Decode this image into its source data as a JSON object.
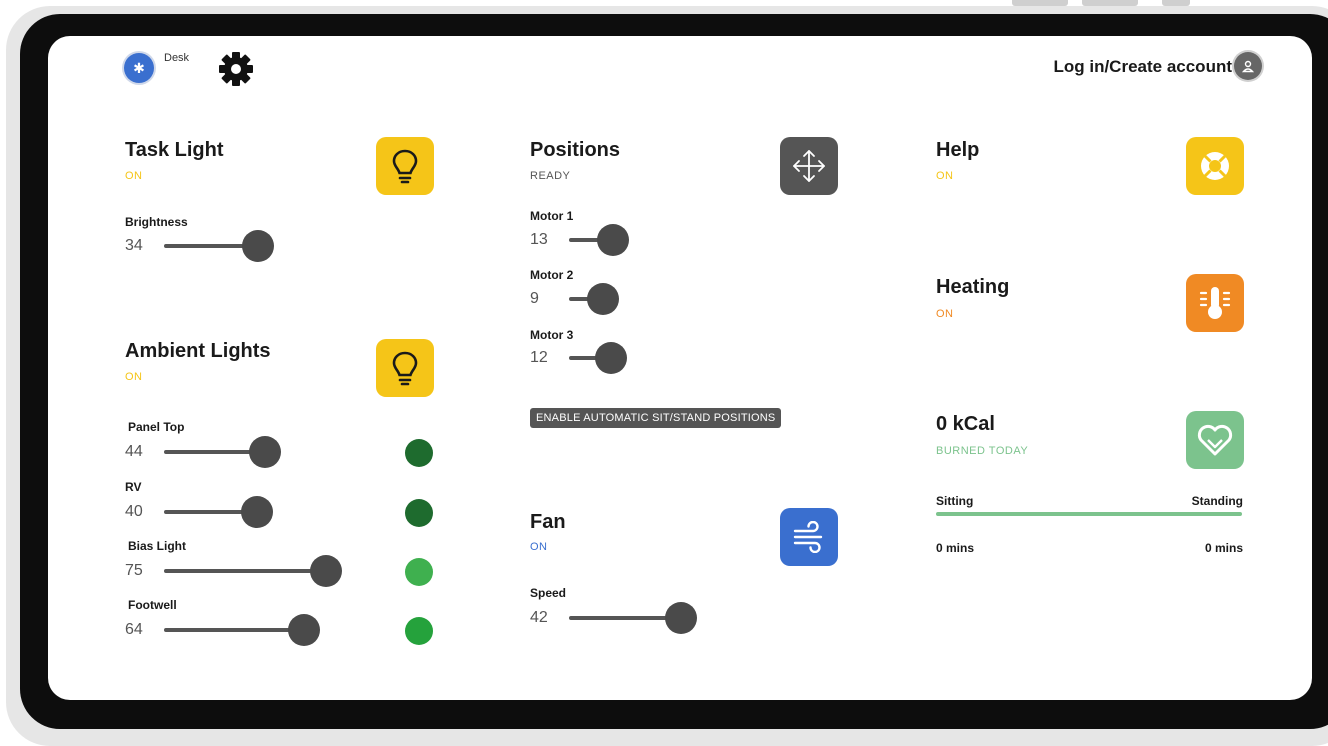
{
  "header": {
    "device_label": "Desk",
    "login_label": "Log in/Create account"
  },
  "task_light": {
    "title": "Task Light",
    "status": "ON",
    "brightness": {
      "label": "Brightness",
      "value": 34
    }
  },
  "ambient_lights": {
    "title": "Ambient Lights",
    "status": "ON",
    "channels": [
      {
        "label": "Panel Top",
        "value": 44,
        "dot_color": "#1e6b2e"
      },
      {
        "label": "RV",
        "value": 40,
        "dot_color": "#1e6b2e"
      },
      {
        "label": "Bias Light",
        "value": 75,
        "dot_color": "#3fb04f"
      },
      {
        "label": "Footwell",
        "value": 64,
        "dot_color": "#25a23c"
      }
    ]
  },
  "positions": {
    "title": "Positions",
    "status": "READY",
    "motors": [
      {
        "label": "Motor 1",
        "value": 13
      },
      {
        "label": "Motor 2",
        "value": 9
      },
      {
        "label": "Motor 3",
        "value": 12
      }
    ],
    "auto_button": "ENABLE AUTOMATIC SIT/STAND POSITIONS"
  },
  "fan": {
    "title": "Fan",
    "status": "ON",
    "speed": {
      "label": "Speed",
      "value": 42
    }
  },
  "help": {
    "title": "Help",
    "status": "ON"
  },
  "heating": {
    "title": "Heating",
    "status": "ON"
  },
  "calories": {
    "title": "0 kCal",
    "status": "BURNED TODAY",
    "sitting_label": "Sitting",
    "standing_label": "Standing",
    "sitting_time": "0 mins",
    "standing_time": "0 mins"
  },
  "colors": {
    "accent_yellow": "#f5c518",
    "tile_grey": "#555555",
    "tile_blue": "#3a6fcf",
    "tile_orange": "#f08a24",
    "tile_green": "#7cc38d"
  },
  "icons": {
    "bluetooth": "bluetooth-icon",
    "settings": "gear-icon",
    "account": "user-icon",
    "task_light": "lightbulb-icon",
    "ambient": "lightbulb-icon",
    "positions": "move-arrows-icon",
    "fan": "wind-icon",
    "help": "lifebuoy-icon",
    "heating": "thermometer-icon",
    "calories": "heart-icon"
  }
}
